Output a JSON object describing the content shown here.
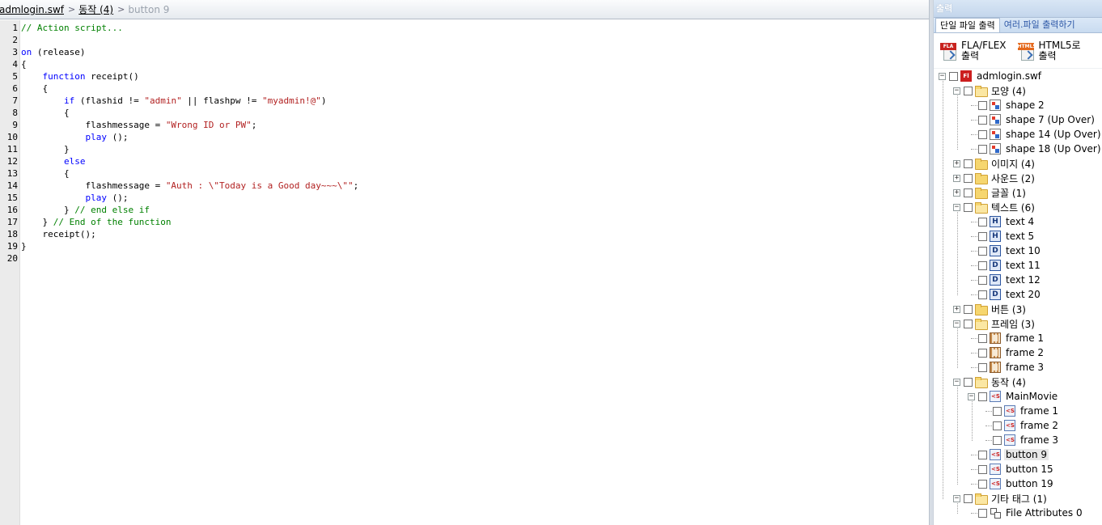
{
  "breadcrumb": {
    "items": [
      "admlogin.swf",
      "동작 (4)",
      "button 9"
    ]
  },
  "editor": {
    "line_numbers": [
      "1",
      "2",
      "3",
      "4",
      "5",
      "6",
      "7",
      "8",
      "9",
      "10",
      "11",
      "12",
      "13",
      "14",
      "15",
      "16",
      "17",
      "18",
      "19",
      "20"
    ],
    "lines": [
      [
        [
          "c",
          "// Action script..."
        ]
      ],
      [],
      [
        [
          "k",
          "on"
        ],
        [
          "p",
          " (release)"
        ]
      ],
      [
        [
          "p",
          "{"
        ]
      ],
      [
        [
          "p",
          "    "
        ],
        [
          "k",
          "function"
        ],
        [
          "p",
          " receipt()"
        ]
      ],
      [
        [
          "p",
          "    {"
        ]
      ],
      [
        [
          "p",
          "        "
        ],
        [
          "k",
          "if"
        ],
        [
          "p",
          " (flashid != "
        ],
        [
          "s",
          "\"admin\""
        ],
        [
          "p",
          " || flashpw != "
        ],
        [
          "s",
          "\"myadmin!@\""
        ],
        [
          "p",
          ")"
        ]
      ],
      [
        [
          "p",
          "        {"
        ]
      ],
      [
        [
          "p",
          "            flashmessage = "
        ],
        [
          "s",
          "\"Wrong ID or PW\""
        ],
        [
          "p",
          ";"
        ]
      ],
      [
        [
          "p",
          "            "
        ],
        [
          "k",
          "play"
        ],
        [
          "p",
          " ();"
        ]
      ],
      [
        [
          "p",
          "        }"
        ]
      ],
      [
        [
          "p",
          "        "
        ],
        [
          "k",
          "else"
        ]
      ],
      [
        [
          "p",
          "        {"
        ]
      ],
      [
        [
          "p",
          "            flashmessage = "
        ],
        [
          "s",
          "\"Auth : \\\"Today is a Good day~~~\\\"\""
        ],
        [
          "p",
          ";"
        ]
      ],
      [
        [
          "p",
          "            "
        ],
        [
          "k",
          "play"
        ],
        [
          "p",
          " ();"
        ]
      ],
      [
        [
          "p",
          "        } "
        ],
        [
          "c",
          "// end else if"
        ]
      ],
      [
        [
          "p",
          "    } "
        ],
        [
          "c",
          "// End of the function"
        ]
      ],
      [
        [
          "p",
          "    receipt();"
        ]
      ],
      [
        [
          "p",
          "}"
        ]
      ],
      []
    ]
  },
  "panel": {
    "title": "출력",
    "tabs": [
      "단일 파일 출력",
      "여러.파일 출력하기"
    ],
    "export_buttons": [
      {
        "label": "FLA/FLEX\n출력",
        "badge": "FLA"
      },
      {
        "label": "HTML5로\n출력",
        "badge": "HTML5"
      }
    ]
  },
  "tree": [
    {
      "level": 0,
      "label": "admlogin.swf",
      "icon": "swf-file-icon",
      "expander": "-",
      "checkbox": true
    },
    {
      "level": 1,
      "label": "모양 (4)",
      "icon": "folder-open-icon",
      "expander": "-",
      "checkbox": true
    },
    {
      "level": 2,
      "label": "shape 2",
      "icon": "shape-icon",
      "checkbox": true
    },
    {
      "level": 2,
      "label": "shape 7 (Up Over)",
      "icon": "shape-icon",
      "checkbox": true
    },
    {
      "level": 2,
      "label": "shape 14 (Up Over)",
      "icon": "shape-icon",
      "checkbox": true
    },
    {
      "level": 2,
      "label": "shape 18 (Up Over)",
      "icon": "shape-icon",
      "checkbox": true
    },
    {
      "level": 1,
      "label": "이미지 (4)",
      "icon": "folder-icon",
      "expander": "+",
      "checkbox": true
    },
    {
      "level": 1,
      "label": "사운드 (2)",
      "icon": "folder-icon",
      "expander": "+",
      "checkbox": true
    },
    {
      "level": 1,
      "label": "글꼴 (1)",
      "icon": "folder-icon",
      "expander": "+",
      "checkbox": true
    },
    {
      "level": 1,
      "label": "텍스트 (6)",
      "icon": "folder-open-icon",
      "expander": "-",
      "checkbox": true
    },
    {
      "level": 2,
      "label": "text 4",
      "icon": "text-h-icon",
      "glyph": "H",
      "checkbox": true
    },
    {
      "level": 2,
      "label": "text 5",
      "icon": "text-h-icon",
      "glyph": "H",
      "checkbox": true
    },
    {
      "level": 2,
      "label": "text 10",
      "icon": "text-d-icon",
      "glyph": "D",
      "checkbox": true
    },
    {
      "level": 2,
      "label": "text 11",
      "icon": "text-d-icon",
      "glyph": "D",
      "checkbox": true
    },
    {
      "level": 2,
      "label": "text 12",
      "icon": "text-d-icon",
      "glyph": "D",
      "checkbox": true
    },
    {
      "level": 2,
      "label": "text 20",
      "icon": "text-d-icon",
      "glyph": "D",
      "checkbox": true
    },
    {
      "level": 1,
      "label": "버튼 (3)",
      "icon": "folder-icon",
      "expander": "+",
      "checkbox": true
    },
    {
      "level": 1,
      "label": "프레임 (3)",
      "icon": "folder-open-icon",
      "expander": "-",
      "checkbox": true
    },
    {
      "level": 2,
      "label": "frame 1",
      "icon": "frame-icon",
      "checkbox": true
    },
    {
      "level": 2,
      "label": "frame 2",
      "icon": "frame-icon",
      "checkbox": true
    },
    {
      "level": 2,
      "label": "frame 3",
      "icon": "frame-icon",
      "checkbox": true
    },
    {
      "level": 1,
      "label": "동작 (4)",
      "icon": "folder-open-icon",
      "expander": "-",
      "checkbox": true
    },
    {
      "level": 2,
      "label": "MainMovie",
      "icon": "script-icon",
      "expander": "-",
      "checkbox": true
    },
    {
      "level": 3,
      "label": "frame 1",
      "icon": "script-icon",
      "checkbox": true
    },
    {
      "level": 3,
      "label": "frame 2",
      "icon": "script-icon",
      "checkbox": true
    },
    {
      "level": 3,
      "label": "frame 3",
      "icon": "script-icon",
      "checkbox": true
    },
    {
      "level": 2,
      "label": "button 9",
      "icon": "script-icon",
      "checkbox": true,
      "selected": true
    },
    {
      "level": 2,
      "label": "button 15",
      "icon": "script-icon",
      "checkbox": true
    },
    {
      "level": 2,
      "label": "button 19",
      "icon": "script-icon",
      "checkbox": true
    },
    {
      "level": 1,
      "label": "기타 태그 (1)",
      "icon": "folder-open-icon",
      "expander": "-",
      "checkbox": true
    },
    {
      "level": 2,
      "label": "File Attributes 0",
      "icon": "attributes-icon",
      "checkbox": true
    }
  ],
  "colors": {
    "comment": "#008000",
    "keyword": "#0000ff",
    "string": "#b22222",
    "panel_accent": "#2b56a6",
    "swf_icon": "#cc1f1f"
  }
}
